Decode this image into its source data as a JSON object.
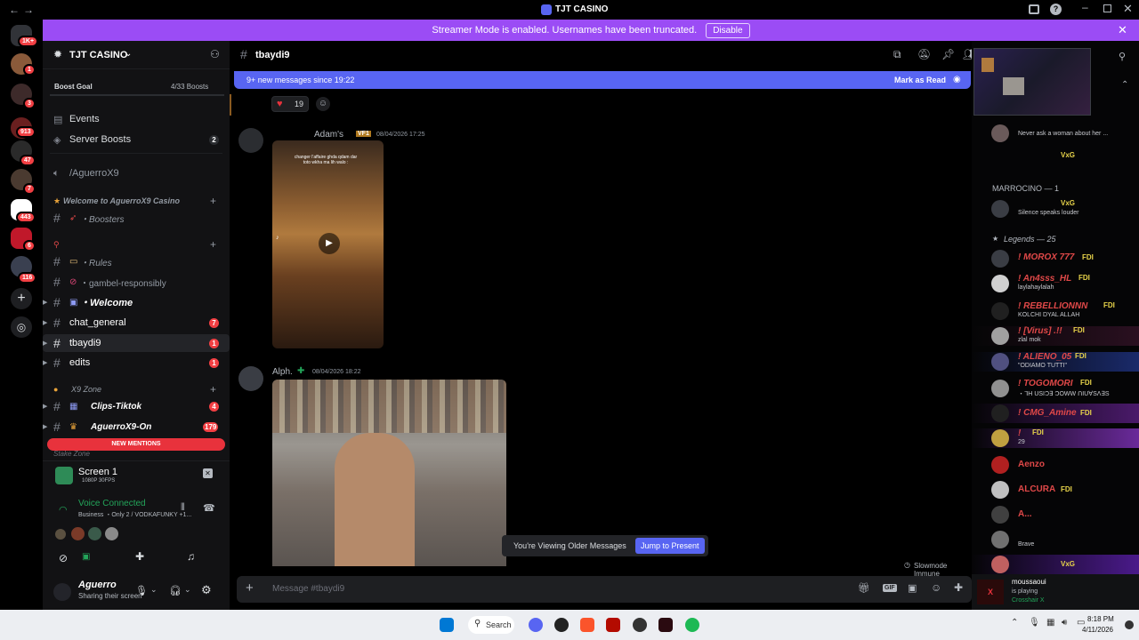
{
  "window": {
    "title": "TJT CASINO"
  },
  "banner": {
    "text": "Streamer Mode is enabled. Usernames have been truncated.",
    "button": "Disable"
  },
  "server_rail": {
    "badges": [
      "1K+",
      "1",
      "3",
      "913",
      "47",
      "7",
      "443",
      "6",
      "116"
    ]
  },
  "server": {
    "name": "TJT CASINO",
    "boost_goal_label": "Boost Goal",
    "boost_count": "4/33 Boosts"
  },
  "channels": {
    "events": "Events",
    "server_boosts": "Server Boosts",
    "server_boosts_count": "2",
    "voice_channel": "/AguerroX9",
    "category_welcome": "Welcome to AguerroX9 Casino",
    "items": [
      {
        "name": "・Boosters",
        "badge": ""
      },
      {
        "name": "・Rules",
        "badge": ""
      },
      {
        "name": "・gambel-responsibly",
        "badge": ""
      },
      {
        "name": "・Welcome",
        "badge": ""
      },
      {
        "name": "chat_general",
        "badge": "7"
      },
      {
        "name": "tbaydi9",
        "badge": "1"
      },
      {
        "name": "edits",
        "badge": "1"
      }
    ],
    "category_x9": "X9 Zone",
    "x9_items": [
      {
        "name": "Clips-Tiktok",
        "badge": "4"
      },
      {
        "name": "AguerroX9-On",
        "badge": "179"
      }
    ],
    "new_mentions": "NEW MENTIONS",
    "stake_zone": "Stake Zone"
  },
  "stream": {
    "title": "Screen 1",
    "quality": "1080P 30FPS"
  },
  "voice": {
    "status": "Voice Connected",
    "location": "Business ・Only 2 / VODKAFUNKY +1..."
  },
  "user": {
    "name": "Aguerro",
    "status": "Sharing their screen"
  },
  "chat": {
    "channel": "tbaydi9",
    "new_messages": "9+ new messages since 19:22",
    "mark_read": "Mark as Read",
    "reaction_count": "19",
    "messages": [
      {
        "author": "Adam's",
        "tag": "VF1",
        "time": "08/04/2026 17:25",
        "caption": "changer l'affaire ghda qdam dar toto wkha ma lih walo :"
      },
      {
        "author": "Alph.",
        "tag": "",
        "time": "08/04/2026 18:22",
        "caption": ""
      }
    ],
    "older_notice": "You're Viewing Older Messages",
    "jump_present": "Jump to Present",
    "slowmode": "Slowmode Immune",
    "input_placeholder": "Message #tbaydi9"
  },
  "members": {
    "top": [
      {
        "name": "",
        "sub": "Never ask a woman about her ..."
      },
      {
        "name": "",
        "sub": "",
        "tag": "VxG"
      }
    ],
    "marrocino_header": "MARROCINO — 1",
    "marrocino": [
      {
        "name": "",
        "sub": "Silence speaks louder",
        "tag": "VxG"
      }
    ],
    "legends_header": "Legends — 25",
    "legends": [
      {
        "name": "! MOROX 777",
        "tag": "FDI",
        "sub": ""
      },
      {
        "name": "! An4sss_HL",
        "tag": "FDI",
        "sub": "laylahaylalah"
      },
      {
        "name": "! REBELLIONNN",
        "tag": "FDI",
        "sub": "KOLCHI DYAL ALLAH"
      },
      {
        "name": "! [Virus] .!!",
        "tag": "FDI",
        "sub": "zlal mok"
      },
      {
        "name": "! ALIENO_05",
        "tag": "FDI",
        "sub": "\"ODIAMO TUTTI\""
      },
      {
        "name": "! TOGOMORI",
        "tag": "FDI",
        "sub": "・ᒣH ᑌSIƆ∃ ƆOWW ᑎIᑌ∀SɅ∃S"
      },
      {
        "name": "! CMG_Amine",
        "tag": "FDI",
        "sub": ""
      },
      {
        "name": "!",
        "tag": "FDI",
        "sub": "29"
      },
      {
        "name": "Aenzo",
        "tag": "",
        "sub": ""
      },
      {
        "name": "ALCURA",
        "tag": "FDI",
        "sub": ""
      },
      {
        "name": "A...",
        "tag": "",
        "sub": ""
      },
      {
        "name": "",
        "tag": "",
        "sub": "Brave"
      },
      {
        "name": "",
        "tag": "VxG",
        "sub": ""
      }
    ]
  },
  "now_playing": {
    "user": "moussaoui",
    "activity": "is playing",
    "game": "Crosshair X"
  },
  "taskbar": {
    "search": "Search",
    "time": "8:18 PM",
    "date": "4/11/2026"
  }
}
